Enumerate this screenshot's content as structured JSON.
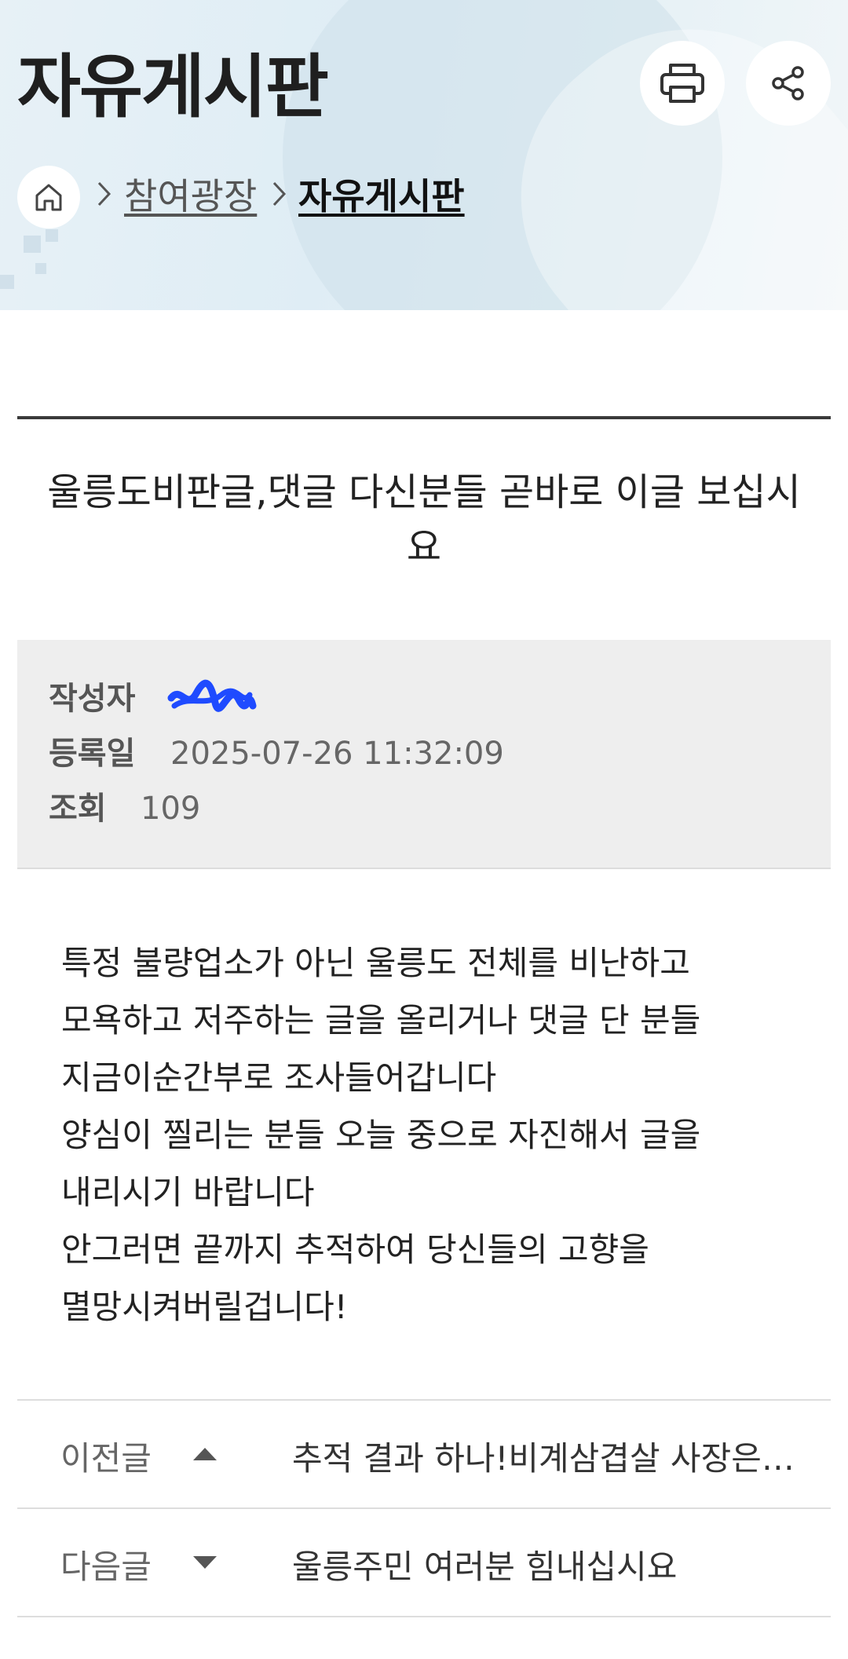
{
  "header": {
    "title": "자유게시판",
    "print_icon": "printer-icon",
    "share_icon": "share-icon"
  },
  "breadcrumb": {
    "home_icon": "home-icon",
    "items": [
      {
        "label": "참여광장"
      },
      {
        "label": "자유게시판"
      }
    ]
  },
  "post": {
    "title": "울릉도비판글,댓글 다신분들 곧바로 이글 보십시요",
    "meta": {
      "author_label": "작성자",
      "author_value": "",
      "date_label": "등록일",
      "date_value": "2025-07-26 11:32:09",
      "views_label": "조회",
      "views_value": "109"
    },
    "body_lines": [
      "특정 불량업소가 아닌 울릉도 전체를 비난하고",
      "모욕하고 저주하는 글을 올리거나 댓글 단 분들",
      "지금이순간부로 조사들어갑니다",
      "양심이 찔리는 분들 오늘 중으로 자진해서 글을",
      "내리시기 바랍니다",
      "안그러면 끝까지 추적하여 당신들의 고향을",
      "멸망시켜버릴겁니다!"
    ]
  },
  "navigation": {
    "prev": {
      "label": "이전글",
      "title": "추적 결과 하나!비계삼겹살 사장은 …"
    },
    "next": {
      "label": "다음글",
      "title": "울릉주민 여러분 힘내십시요"
    }
  },
  "colors": {
    "hero_bg": "#e3eff5",
    "meta_bg": "#eeeeee",
    "redaction": "#1f4bff"
  }
}
